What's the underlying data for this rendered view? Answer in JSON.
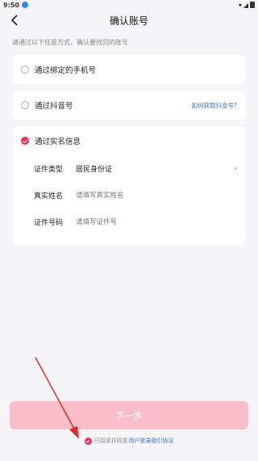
{
  "status_bar": {
    "time": "9:50"
  },
  "header": {
    "title": "确认账号"
  },
  "hint": "请通过以下任意方式，确认要找回的账号",
  "options": [
    {
      "label": "通过绑定的手机号",
      "checked": false
    },
    {
      "label": "通过抖音号",
      "link": "如何获取抖音号?",
      "checked": false
    },
    {
      "label": "通过实名信息",
      "checked": true
    }
  ],
  "realname_fields": {
    "id_type_label": "证件类型",
    "id_type_value": "居民身份证",
    "name_label": "真实姓名",
    "name_placeholder": "请填写真实姓名",
    "id_number_label": "证件号码",
    "id_number_placeholder": "请填写证件号"
  },
  "next_button": "下一步",
  "agreement": {
    "text": "已阅读并同意",
    "link": "用户登录指引协议"
  },
  "colors": {
    "accent": "#f12d5c",
    "button_disabled": "#f8bfca",
    "link": "#3b6ec7"
  }
}
